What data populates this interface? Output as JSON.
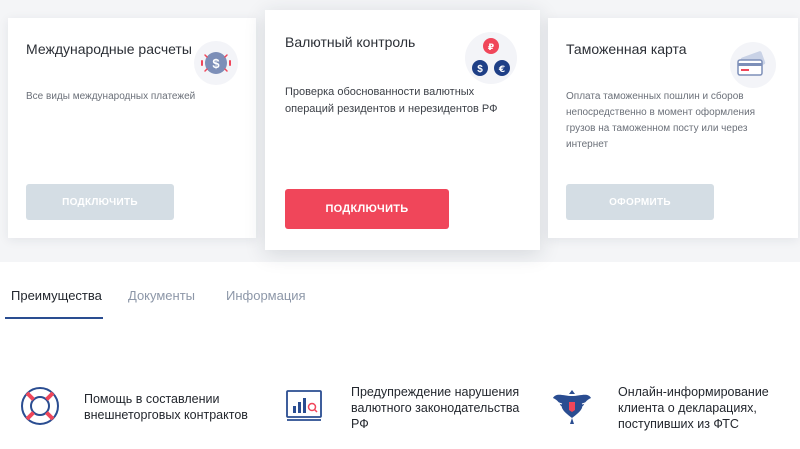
{
  "cards": [
    {
      "title": "Международные расчеты",
      "description": "Все виды международных платежей",
      "button": "Подключить",
      "icon": "dollar-coin-icon",
      "state": "disabled"
    },
    {
      "title": "Валютный контроль",
      "description_lines": [
        "Проверка обоснованности валютных",
        "операций резидентов и нерезидентов РФ"
      ],
      "button": "Подключить",
      "icon": "currency-exchange-icon",
      "state": "active"
    },
    {
      "title": "Таможенная карта",
      "description_lines": [
        "Оплата таможенных пошлин и сборов",
        "непосредственно в момент оформления",
        "грузов на таможенном посту или через",
        "интернет"
      ],
      "button": "Оформить",
      "icon": "credit-card-icon",
      "state": "disabled"
    }
  ],
  "tabs": [
    {
      "label": "Преимущества",
      "active": true
    },
    {
      "label": "Документы",
      "active": false
    },
    {
      "label": "Информация",
      "active": false
    }
  ],
  "features": [
    {
      "lines": [
        "Помощь в составлении",
        "внешнеторговых контрактов"
      ],
      "icon": "lifebuoy-icon"
    },
    {
      "lines": [
        "Предупреждение нарушения",
        "валютного законодательства",
        "РФ"
      ],
      "icon": "analytics-chart-icon"
    },
    {
      "lines": [
        "Онлайн-информирование",
        "клиента о декларациях,",
        "поступивших из ФТС"
      ],
      "icon": "russian-emblem-icon"
    }
  ],
  "colors": {
    "accent": "#f0465a",
    "disabled_button": "#d4dde4",
    "brand_blue": "#2a4d91",
    "tab_inactive": "#8d97a8"
  }
}
